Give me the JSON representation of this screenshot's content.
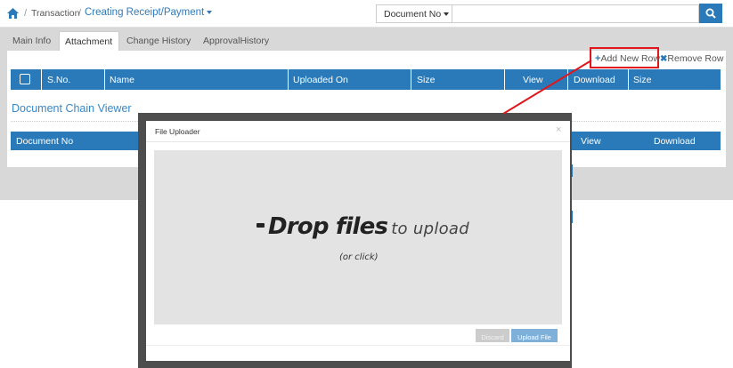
{
  "breadcrumb": {
    "level1": "Transaction",
    "separator": "/",
    "current": "Creating Receipt/Payment"
  },
  "search": {
    "filter_label": "Document No",
    "value": "",
    "placeholder": ""
  },
  "tabs": [
    {
      "label": "Main Info",
      "active": false
    },
    {
      "label": "Attachment",
      "active": true
    },
    {
      "label": "Change History",
      "active": false
    },
    {
      "label": "ApprovalHistory",
      "active": false
    }
  ],
  "attachment": {
    "add_row_label": "Add New Row",
    "remove_row_label": "Remove Row",
    "columns": [
      "S.No.",
      "Name",
      "Uploaded On",
      "Size",
      "View",
      "Download",
      "Size"
    ]
  },
  "chain": {
    "title": "Document Chain Viewer",
    "columns": [
      "Document No",
      "View",
      "Download"
    ]
  },
  "modal": {
    "title": "File Uploader",
    "close_label": "×",
    "drop_strong": "Drop files",
    "drop_light": "to upload",
    "drop_sub": "(or click)",
    "discard_label": "Discard",
    "upload_label": "Upload File"
  },
  "colors": {
    "primary": "#2a7ab9",
    "annotation": "#e0161c",
    "tab_band": "#d8d8d8",
    "modal_frame": "#4d4d4d",
    "dropzone": "#e3e3e3"
  },
  "icons": {
    "home": "home-icon",
    "search": "search-icon",
    "plus": "plus-icon",
    "remove": "x-icon",
    "close": "close-icon"
  }
}
